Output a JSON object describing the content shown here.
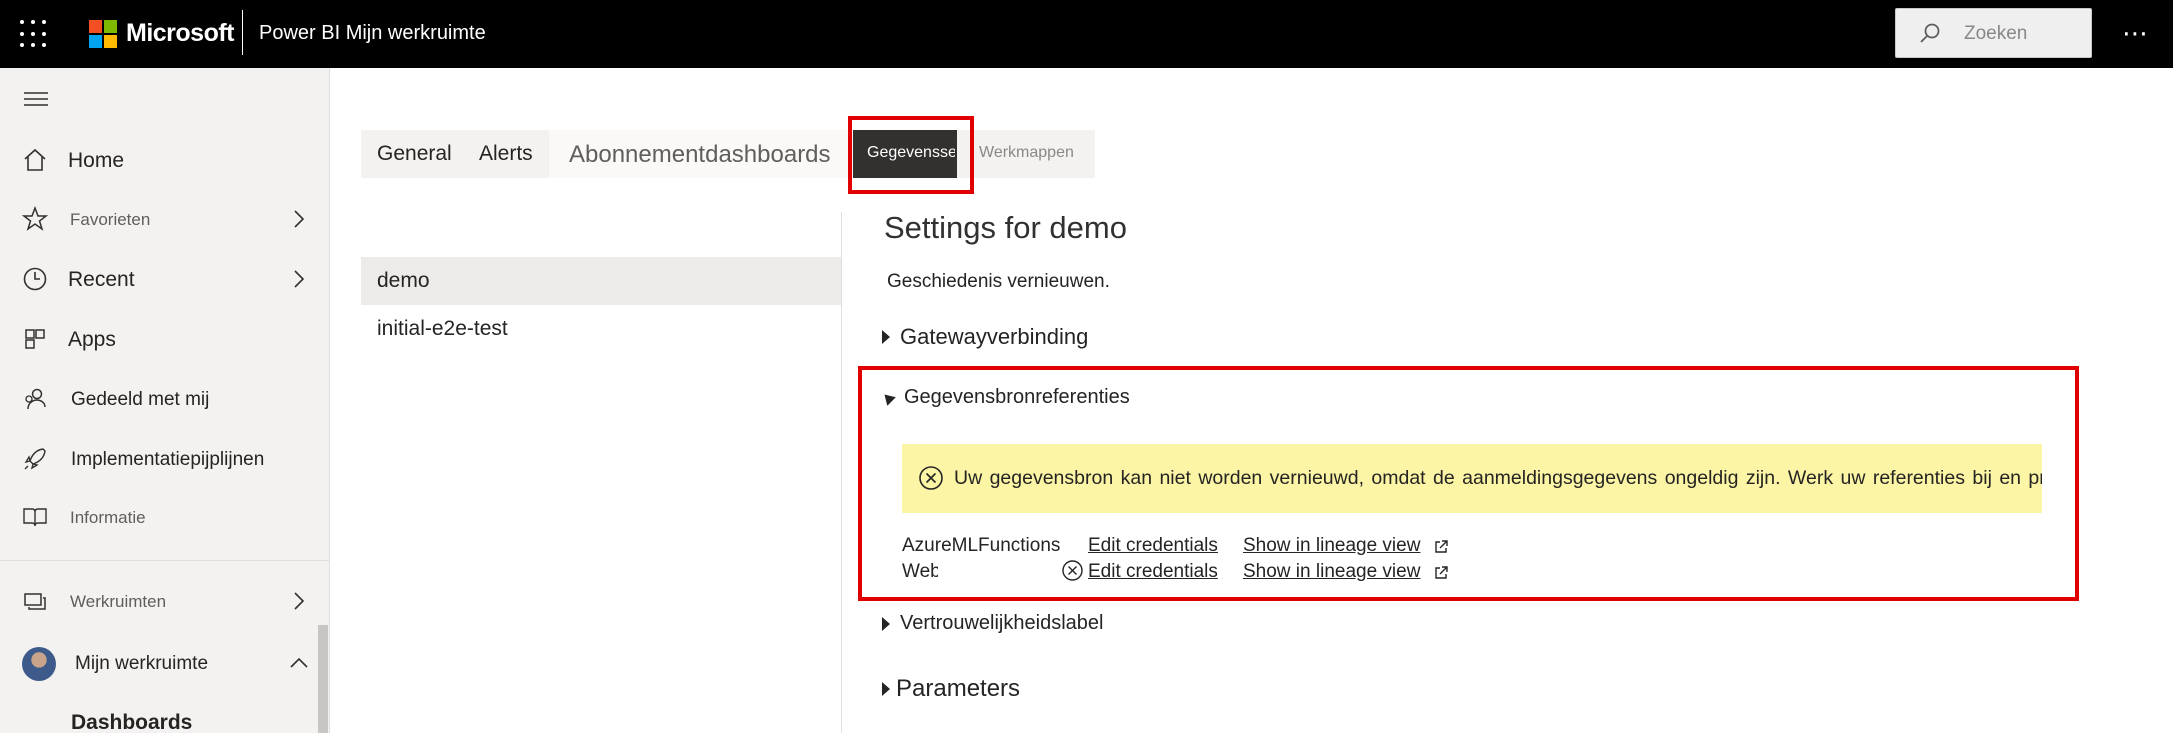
{
  "topbar": {
    "brand": "Microsoft",
    "app_title": "Power BI Mijn werkruimte",
    "search_placeholder": "Zoeken",
    "more": "⋯"
  },
  "sidebar": {
    "items": [
      {
        "label": "Home",
        "icon": "home-icon"
      },
      {
        "label": "Favorieten",
        "icon": "star-icon"
      },
      {
        "label": "Recent",
        "icon": "clock-icon"
      },
      {
        "label": "Apps",
        "icon": "apps-icon"
      },
      {
        "label": "Gedeeld met mij",
        "icon": "people-icon"
      },
      {
        "label": "Implementatiepijplijnen",
        "icon": "rocket-icon"
      },
      {
        "label": "Informatie",
        "icon": "book-icon"
      },
      {
        "label": "Werkruimten",
        "icon": "workspaces-icon"
      },
      {
        "label": "Mijn werkruimte",
        "icon": "avatar"
      }
    ],
    "sub_item": "Dashboards"
  },
  "tabs": [
    {
      "label": "General"
    },
    {
      "label": "Alerts"
    },
    {
      "label": "Abonnementdashboards"
    },
    {
      "label": "Gegevenssets"
    },
    {
      "label": "Werkmappen"
    }
  ],
  "datasets": [
    {
      "label": "demo"
    },
    {
      "label": "initial-e2e-test"
    }
  ],
  "settings": {
    "title": "Settings for demo",
    "history_link": "Geschiedenis vernieuwen.",
    "sections": {
      "gateway": "Gatewayverbinding",
      "credentials": "Gegevensbronreferenties",
      "sensitivity": "Vertrouwelijkheidslabel",
      "parameters": "Parameters"
    },
    "warning": "Uw gegevensbron kan niet worden vernieuwd, omdat de aanmeldingsgegevens ongeldig zijn. Werk uw referenties bij en probeer het op",
    "credentials": [
      {
        "name": "AzureMLFunctions",
        "edit": "Edit credentials",
        "lineage": "Show in lineage view"
      },
      {
        "name": "Web",
        "edit": "Edit credentials",
        "lineage": "Show in lineage view"
      }
    ]
  },
  "colors": {
    "topbar": "#000000",
    "highlight": "#e00000",
    "warning_bg": "#fbf5a5",
    "active_tab": "#323130"
  }
}
